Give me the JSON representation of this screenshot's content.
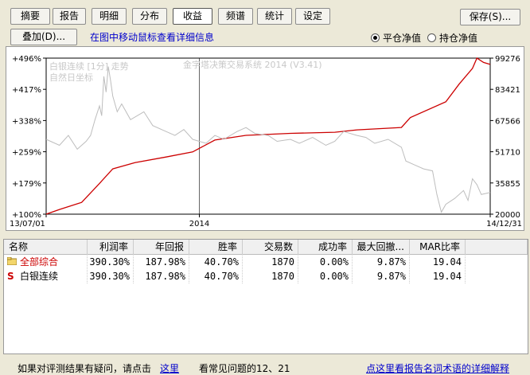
{
  "tabs": [
    "摘要",
    "报告",
    "明细",
    "分布",
    "收益",
    "频谱",
    "统计",
    "设定"
  ],
  "save_label": "保存(S)...",
  "overlay_label": "叠加(D)...",
  "hint": "在图中移动鼠标查看详细信息",
  "radio": {
    "option1": "平仓净值",
    "option2": "持仓净值"
  },
  "chart_overlay": {
    "legend1": "白银连续 [1分] 走势",
    "legend2": "自然日坐标",
    "watermark": "金字塔决策交易系统 2014 (V3.41)"
  },
  "chart_data": {
    "type": "line",
    "y_left_ticks": [
      "+496%",
      "+417%",
      "+338%",
      "+259%",
      "+179%",
      "+100%"
    ],
    "y_right_ticks": [
      "99276",
      "83421",
      "67566",
      "51710",
      "35855",
      "20000"
    ],
    "x_ticks": [
      "13/07/01",
      "2014",
      "14/12/31"
    ],
    "ylim_left": [
      100,
      496
    ],
    "ylim_right": [
      20000,
      99276
    ],
    "series": [
      {
        "color": "#cc0000",
        "axis": "left",
        "points": [
          [
            0,
            100
          ],
          [
            0.03,
            112
          ],
          [
            0.08,
            130
          ],
          [
            0.12,
            178
          ],
          [
            0.15,
            215
          ],
          [
            0.2,
            231
          ],
          [
            0.27,
            245
          ],
          [
            0.33,
            258
          ],
          [
            0.38,
            288
          ],
          [
            0.45,
            300
          ],
          [
            0.55,
            305
          ],
          [
            0.65,
            308
          ],
          [
            0.7,
            314
          ],
          [
            0.8,
            320
          ],
          [
            0.82,
            345
          ],
          [
            0.9,
            385
          ],
          [
            0.93,
            430
          ],
          [
            0.96,
            470
          ],
          [
            0.97,
            496
          ],
          [
            0.985,
            485
          ],
          [
            1,
            480
          ]
        ]
      },
      {
        "color": "#bdbdbd",
        "axis": "right",
        "points": [
          [
            0,
            58000
          ],
          [
            0.03,
            55000
          ],
          [
            0.05,
            60000
          ],
          [
            0.07,
            53000
          ],
          [
            0.09,
            57000
          ],
          [
            0.1,
            60000
          ],
          [
            0.11,
            68000
          ],
          [
            0.12,
            75000
          ],
          [
            0.125,
            70000
          ],
          [
            0.13,
            90000
          ],
          [
            0.135,
            82000
          ],
          [
            0.14,
            95000
          ],
          [
            0.145,
            88000
          ],
          [
            0.15,
            80000
          ],
          [
            0.16,
            72000
          ],
          [
            0.17,
            76000
          ],
          [
            0.19,
            68000
          ],
          [
            0.22,
            72000
          ],
          [
            0.24,
            65000
          ],
          [
            0.27,
            62000
          ],
          [
            0.29,
            60000
          ],
          [
            0.31,
            63000
          ],
          [
            0.33,
            58000
          ],
          [
            0.36,
            56000
          ],
          [
            0.38,
            60000
          ],
          [
            0.4,
            58000
          ],
          [
            0.43,
            62000
          ],
          [
            0.45,
            64000
          ],
          [
            0.47,
            61000
          ],
          [
            0.5,
            60000
          ],
          [
            0.52,
            57000
          ],
          [
            0.55,
            58000
          ],
          [
            0.57,
            56000
          ],
          [
            0.6,
            59000
          ],
          [
            0.63,
            55000
          ],
          [
            0.65,
            57000
          ],
          [
            0.67,
            62000
          ],
          [
            0.7,
            60000
          ],
          [
            0.72,
            59000
          ],
          [
            0.74,
            56000
          ],
          [
            0.77,
            58000
          ],
          [
            0.8,
            54000
          ],
          [
            0.81,
            47000
          ],
          [
            0.83,
            45000
          ],
          [
            0.85,
            43000
          ],
          [
            0.87,
            42000
          ],
          [
            0.88,
            30000
          ],
          [
            0.89,
            21000
          ],
          [
            0.9,
            25000
          ],
          [
            0.92,
            28000
          ],
          [
            0.94,
            32000
          ],
          [
            0.95,
            27000
          ],
          [
            0.96,
            38000
          ],
          [
            0.97,
            35000
          ],
          [
            0.98,
            30000
          ],
          [
            1,
            31000
          ]
        ]
      }
    ]
  },
  "table": {
    "headers": [
      "名称",
      "利润率",
      "年回报",
      "胜率",
      "交易数",
      "成功率",
      "最大回撤...",
      "MAR比率"
    ],
    "rows": [
      {
        "name": "全部综合",
        "icon": "folder-icon",
        "values": [
          "390.30%",
          "187.98%",
          "40.70%",
          "1870",
          "0.00%",
          "9.87%",
          "19.04"
        ]
      },
      {
        "name": "白银连续",
        "icon": "s-icon",
        "values": [
          "390.30%",
          "187.98%",
          "40.70%",
          "1870",
          "0.00%",
          "9.87%",
          "19.04"
        ]
      }
    ]
  },
  "footer": {
    "text1": "如果对评测结果有疑问，请点击",
    "link1": "这里",
    "text2": "看常见问题的12、21",
    "link2": "点这里看报告名词术语的详细解释"
  }
}
